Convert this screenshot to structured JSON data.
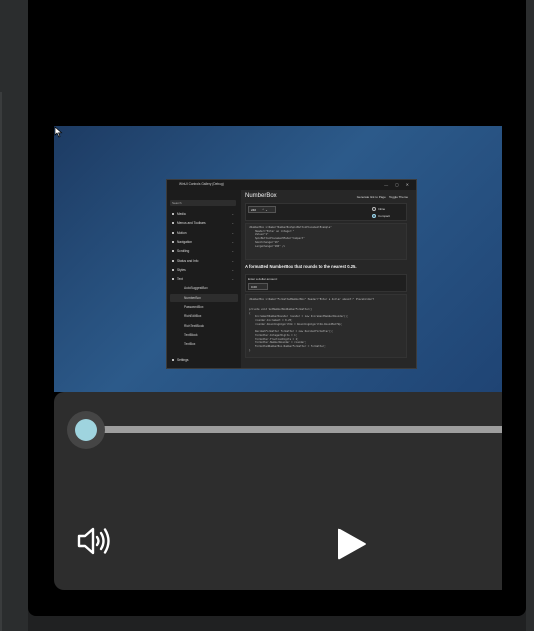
{
  "player": {
    "progress_fraction": 0.0,
    "volume_icon": "volume-icon",
    "play_icon": "play-icon"
  },
  "video_frame": {
    "app_title": "WinUI Controls Gallery (Debug)",
    "window_controls": "— ◻ ✕",
    "search_placeholder": "Search",
    "nav_items": [
      {
        "label": "Media",
        "sub": false
      },
      {
        "label": "Menus and Toolbars",
        "sub": false
      },
      {
        "label": "Motion",
        "sub": false
      },
      {
        "label": "Navigation",
        "sub": false
      },
      {
        "label": "Scrolling",
        "sub": false
      },
      {
        "label": "Status and Info",
        "sub": false
      },
      {
        "label": "Styles",
        "sub": false
      },
      {
        "label": "Text",
        "sub": false
      },
      {
        "label": "AutoSuggestBox",
        "sub": true
      },
      {
        "label": "NumberBox",
        "sub": true,
        "selected": true
      },
      {
        "label": "PasswordBox",
        "sub": true
      },
      {
        "label": "RichEditBox",
        "sub": true
      },
      {
        "label": "RichTextBlock",
        "sub": true
      },
      {
        "label": "TextBlock",
        "sub": true
      },
      {
        "label": "TextBox",
        "sub": true
      }
    ],
    "settings_label": "Settings",
    "page_title": "NumberBox",
    "toplink_1": "Generate link to Page",
    "toplink_2": "Toggle Theme",
    "spin_value": "240",
    "spin_buttons": "⌃ ⌄",
    "radio_inline": "Inline",
    "radio_compact": "Compact",
    "xaml_1": "<NumberBox x:Name=\"NumberBoxSpinButtonPlacementExample\"\n    Header=\"Enter an integer:\"\n    Value=\"1\"\n    SpinButtonPlacementMode=\"Compact\"\n    SmallChange=\"10\"\n    LargeChange=\"100\" />",
    "section_heading": "A formatted NumberBox that rounds to the nearest 0.25.",
    "dollar_label": "Enter a dollar amount:",
    "dollar_value": "0.00",
    "xaml_2": "<NumberBox x:Name=\"FormattedNumberBox\" Header=\"Enter a dollar amount:\" PlaceholderT",
    "csharp": "private void SetNumberBoxNumberFormatter()\n{\n    IncrementNumberRounder rounder = new IncrementNumberRounder();\n    rounder.Increment = 0.25;\n    rounder.RoundingAlgorithm = RoundingAlgorithm.RoundHalfUp;\n\n    DecimalFormatter formatter = new DecimalFormatter();\n    formatter.IntegerDigits = 1;\n    formatter.FractionDigits = 2;\n    formatter.NumberRounder = rounder;\n    FormattedNumberBox.NumberFormatter = formatter;\n}"
  }
}
